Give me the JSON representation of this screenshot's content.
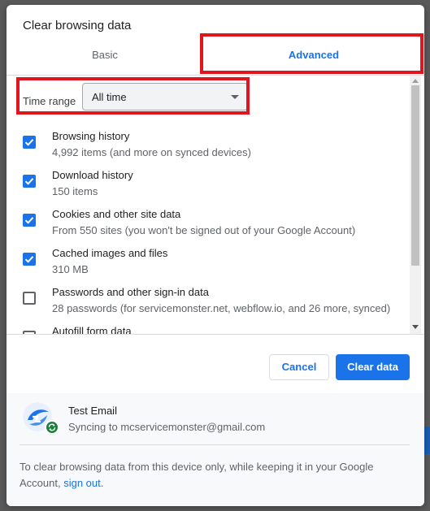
{
  "dialog": {
    "title": "Clear browsing data",
    "tabs": [
      {
        "label": "Basic",
        "active": false
      },
      {
        "label": "Advanced",
        "active": true
      }
    ]
  },
  "time_range": {
    "label": "Time range",
    "selected": "All time"
  },
  "items": [
    {
      "title": "Browsing history",
      "subtitle": "4,992 items (and more on synced devices)",
      "checked": true
    },
    {
      "title": "Download history",
      "subtitle": "150 items",
      "checked": true
    },
    {
      "title": "Cookies and other site data",
      "subtitle": "From 550 sites (you won't be signed out of your Google Account)",
      "checked": true
    },
    {
      "title": "Cached images and files",
      "subtitle": "310 MB",
      "checked": true
    },
    {
      "title": "Passwords and other sign-in data",
      "subtitle": "28 passwords (for servicemonster.net, webflow.io, and 26 more, synced)",
      "checked": false
    },
    {
      "title": "Autofill form data",
      "subtitle": "",
      "checked": false
    }
  ],
  "buttons": {
    "cancel": "Cancel",
    "clear": "Clear data"
  },
  "account": {
    "name": "Test Email",
    "sync_text": "Syncing to mcservicemonster@gmail.com"
  },
  "footer": {
    "text": "To clear browsing data from this device only, while keeping it in your Google Account,",
    "link": "sign out",
    "after_link": "."
  },
  "colors": {
    "accent": "#1a73e8",
    "highlight_box": "#e1151e"
  },
  "icons": [
    "checkbox-checked-icon",
    "checkbox-unchecked-icon",
    "dropdown-caret-icon",
    "sync-icon",
    "avatar-logo-icon"
  ]
}
